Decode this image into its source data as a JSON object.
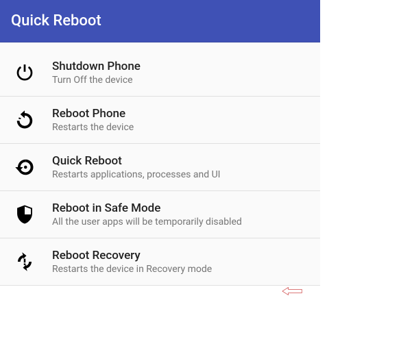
{
  "header": {
    "title": "Quick Reboot"
  },
  "items": [
    {
      "icon": "power",
      "title": "Shutdown Phone",
      "subtitle": "Turn Off the device"
    },
    {
      "icon": "restart",
      "title": "Reboot Phone",
      "subtitle": "Restarts the device"
    },
    {
      "icon": "history",
      "title": "Quick Reboot",
      "subtitle": "Restarts applications, processes and UI"
    },
    {
      "icon": "shield",
      "title": "Reboot in Safe Mode",
      "subtitle": "All the user apps will be temporarily disabled"
    },
    {
      "icon": "recovery",
      "title": "Reboot Recovery",
      "subtitle": "Restarts the device in Recovery mode"
    }
  ],
  "annotation": {
    "arrow_color": "#c62828"
  }
}
